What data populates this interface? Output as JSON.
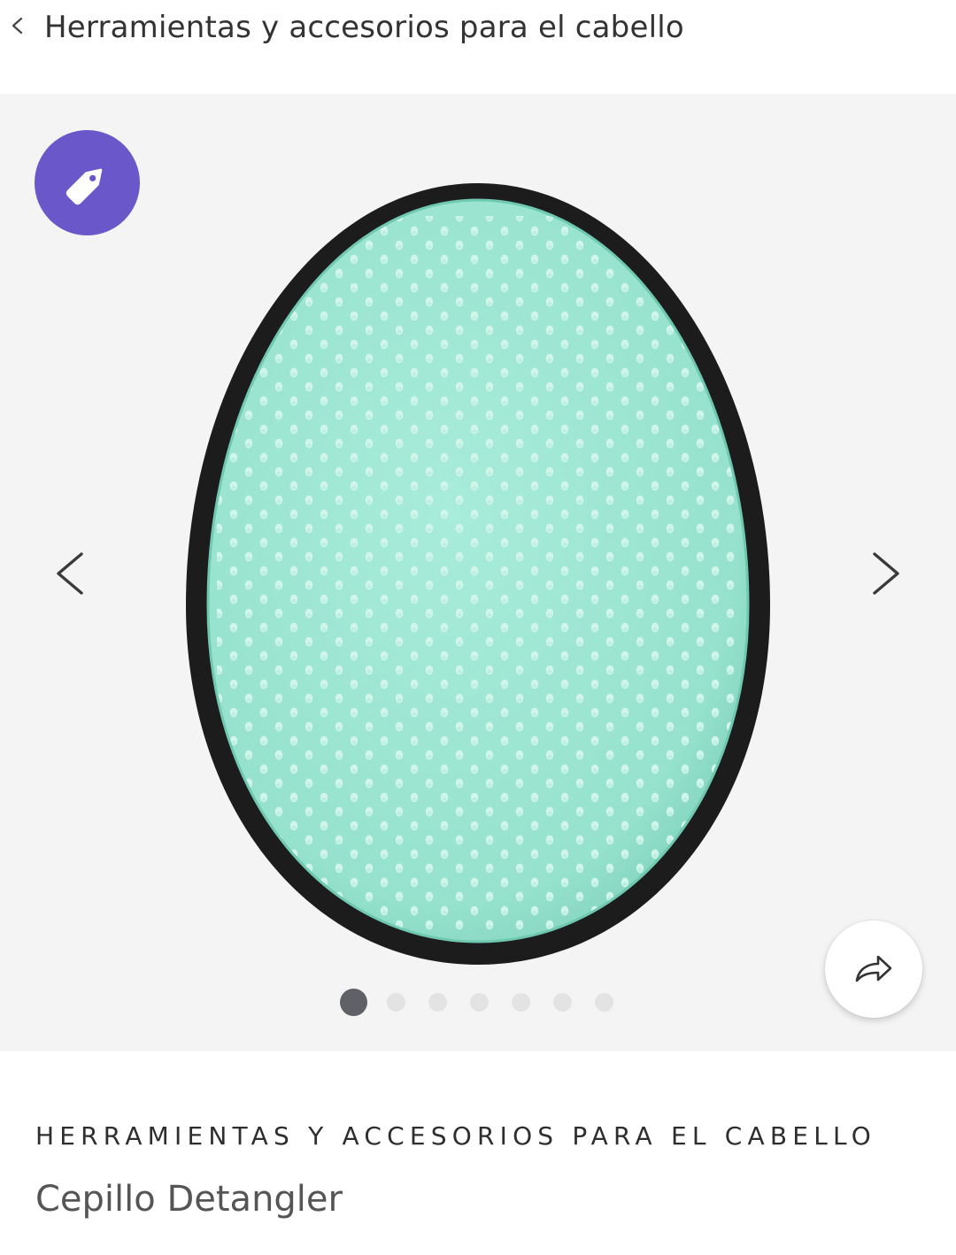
{
  "header": {
    "back_icon": "chevron-left-icon",
    "breadcrumb": "Herramientas y accesorios para el cabello"
  },
  "gallery": {
    "badge_icon": "price-tag-icon",
    "badge_color": "#6a57c9",
    "image_subject": "oval detangling hair brush, mint bristle pad with black rim",
    "prev_icon": "chevron-left-icon",
    "next_icon": "chevron-right-icon",
    "share_icon": "share-arrow-icon",
    "image_count": 7,
    "active_index": 0
  },
  "product": {
    "category": "HERRAMIENTAS Y ACCESORIOS PARA EL CABELLO",
    "name": "Cepillo Detangler"
  },
  "colors": {
    "gallery_bg": "#f4f4f4",
    "brush_rim": "#1c1c1c",
    "brush_pad": "#9fe6d3",
    "dot_active": "#5f6166",
    "dot_inactive": "#e3e3e3"
  }
}
